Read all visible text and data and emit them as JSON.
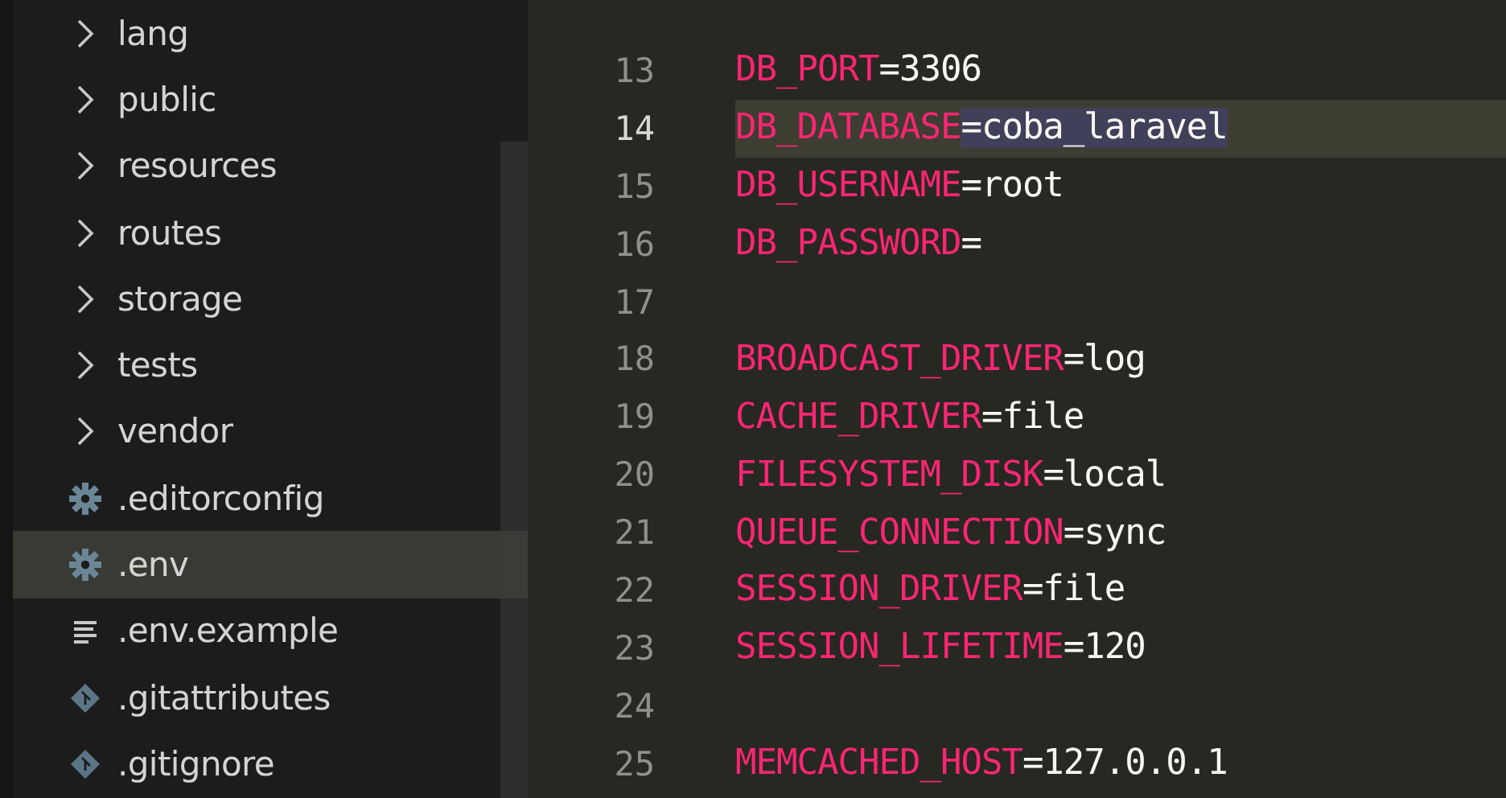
{
  "sidebar": {
    "items": [
      {
        "name": "lang",
        "kind": "folder",
        "selected": false
      },
      {
        "name": "public",
        "kind": "folder",
        "selected": false
      },
      {
        "name": "resources",
        "kind": "folder",
        "selected": false
      },
      {
        "name": "routes",
        "kind": "folder",
        "selected": false
      },
      {
        "name": "storage",
        "kind": "folder",
        "selected": false
      },
      {
        "name": "tests",
        "kind": "folder",
        "selected": false
      },
      {
        "name": "vendor",
        "kind": "folder",
        "selected": false
      },
      {
        "name": ".editorconfig",
        "kind": "settings",
        "selected": false
      },
      {
        "name": ".env",
        "kind": "settings",
        "selected": true
      },
      {
        "name": ".env.example",
        "kind": "text",
        "selected": false
      },
      {
        "name": ".gitattributes",
        "kind": "git",
        "selected": false
      },
      {
        "name": ".gitignore",
        "kind": "git",
        "selected": false
      }
    ]
  },
  "editor": {
    "lines": [
      {
        "number": "13",
        "key": "DB_PORT",
        "value": "=3306",
        "current": false,
        "value_selected": false
      },
      {
        "number": "14",
        "key": "DB_DATABASE",
        "value": "=coba_laravel",
        "current": true,
        "value_selected": true
      },
      {
        "number": "15",
        "key": "DB_USERNAME",
        "value": "=root",
        "current": false,
        "value_selected": false
      },
      {
        "number": "16",
        "key": "DB_PASSWORD",
        "value": "=",
        "current": false,
        "value_selected": false
      },
      {
        "number": "17",
        "current": false
      },
      {
        "number": "18",
        "key": "BROADCAST_DRIVER",
        "value": "=log",
        "current": false,
        "value_selected": false
      },
      {
        "number": "19",
        "key": "CACHE_DRIVER",
        "value": "=file",
        "current": false,
        "value_selected": false
      },
      {
        "number": "20",
        "key": "FILESYSTEM_DISK",
        "value": "=local",
        "current": false,
        "value_selected": false
      },
      {
        "number": "21",
        "key": "QUEUE_CONNECTION",
        "value": "=sync",
        "current": false,
        "value_selected": false
      },
      {
        "number": "22",
        "key": "SESSION_DRIVER",
        "value": "=file",
        "current": false,
        "value_selected": false
      },
      {
        "number": "23",
        "key": "SESSION_LIFETIME",
        "value": "=120",
        "current": false,
        "value_selected": false
      },
      {
        "number": "24",
        "current": false
      },
      {
        "number": "25",
        "key": "MEMCACHED_HOST",
        "value": "=127.0.0.1",
        "current": false,
        "value_selected": false
      }
    ]
  }
}
